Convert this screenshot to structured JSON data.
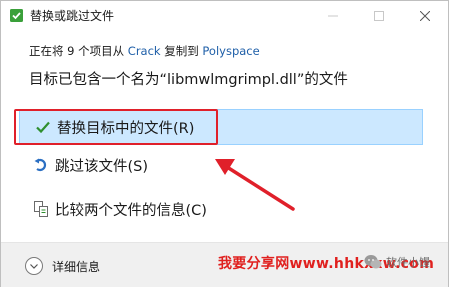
{
  "window": {
    "title": "替换或跳过文件",
    "minimize_glyph": "—",
    "maximize_glyph": "☐",
    "close_glyph": "✕"
  },
  "info": {
    "prefix": "正在将 9 个项目从 ",
    "source": "Crack",
    "middle": " 复制到 ",
    "destination": "Polyspace"
  },
  "conflict_text": "目标已包含一个名为“libmwlmgrimpl.dll”的文件",
  "options": [
    {
      "label": "替换目标中的文件(R)",
      "icon": "checkmark-icon",
      "selected": true
    },
    {
      "label": "跳过该文件(S)",
      "icon": "skip-arrow-icon",
      "selected": false
    },
    {
      "label": "比较两个文件的信息(C)",
      "icon": "compare-files-icon",
      "selected": false
    }
  ],
  "footer": {
    "details_label": "详细信息",
    "watermark": "我要分享网www.hhkxxw.com",
    "wechat_label": "软件小馒"
  },
  "colors": {
    "selected_bg": "#cce8ff",
    "annotation_red": "#e0202a",
    "link_blue": "#1f5fa8",
    "check_green": "#2f8f2f"
  }
}
